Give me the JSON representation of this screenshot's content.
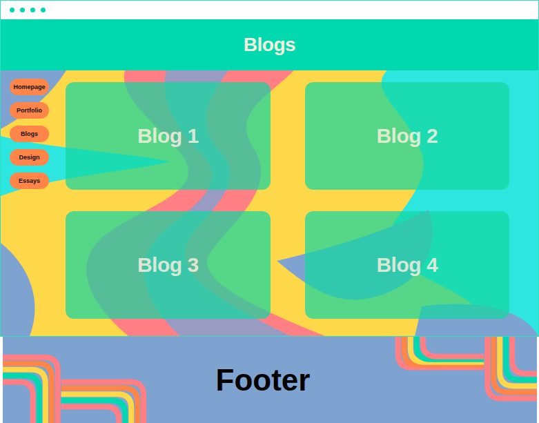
{
  "header": {
    "title": "Blogs"
  },
  "sidebar": {
    "items": [
      {
        "label": "Homepage",
        "selected": false
      },
      {
        "label": "Portfolio",
        "selected": false
      },
      {
        "label": "Blogs",
        "selected": false
      },
      {
        "label": "Design",
        "selected": false
      },
      {
        "label": "Essays",
        "selected": false
      }
    ]
  },
  "cards": [
    {
      "title": "Blog 1"
    },
    {
      "title": "Blog 2"
    },
    {
      "title": "Blog 3"
    },
    {
      "title": "Blog 4"
    }
  ],
  "footer": {
    "text": "Footer"
  }
}
